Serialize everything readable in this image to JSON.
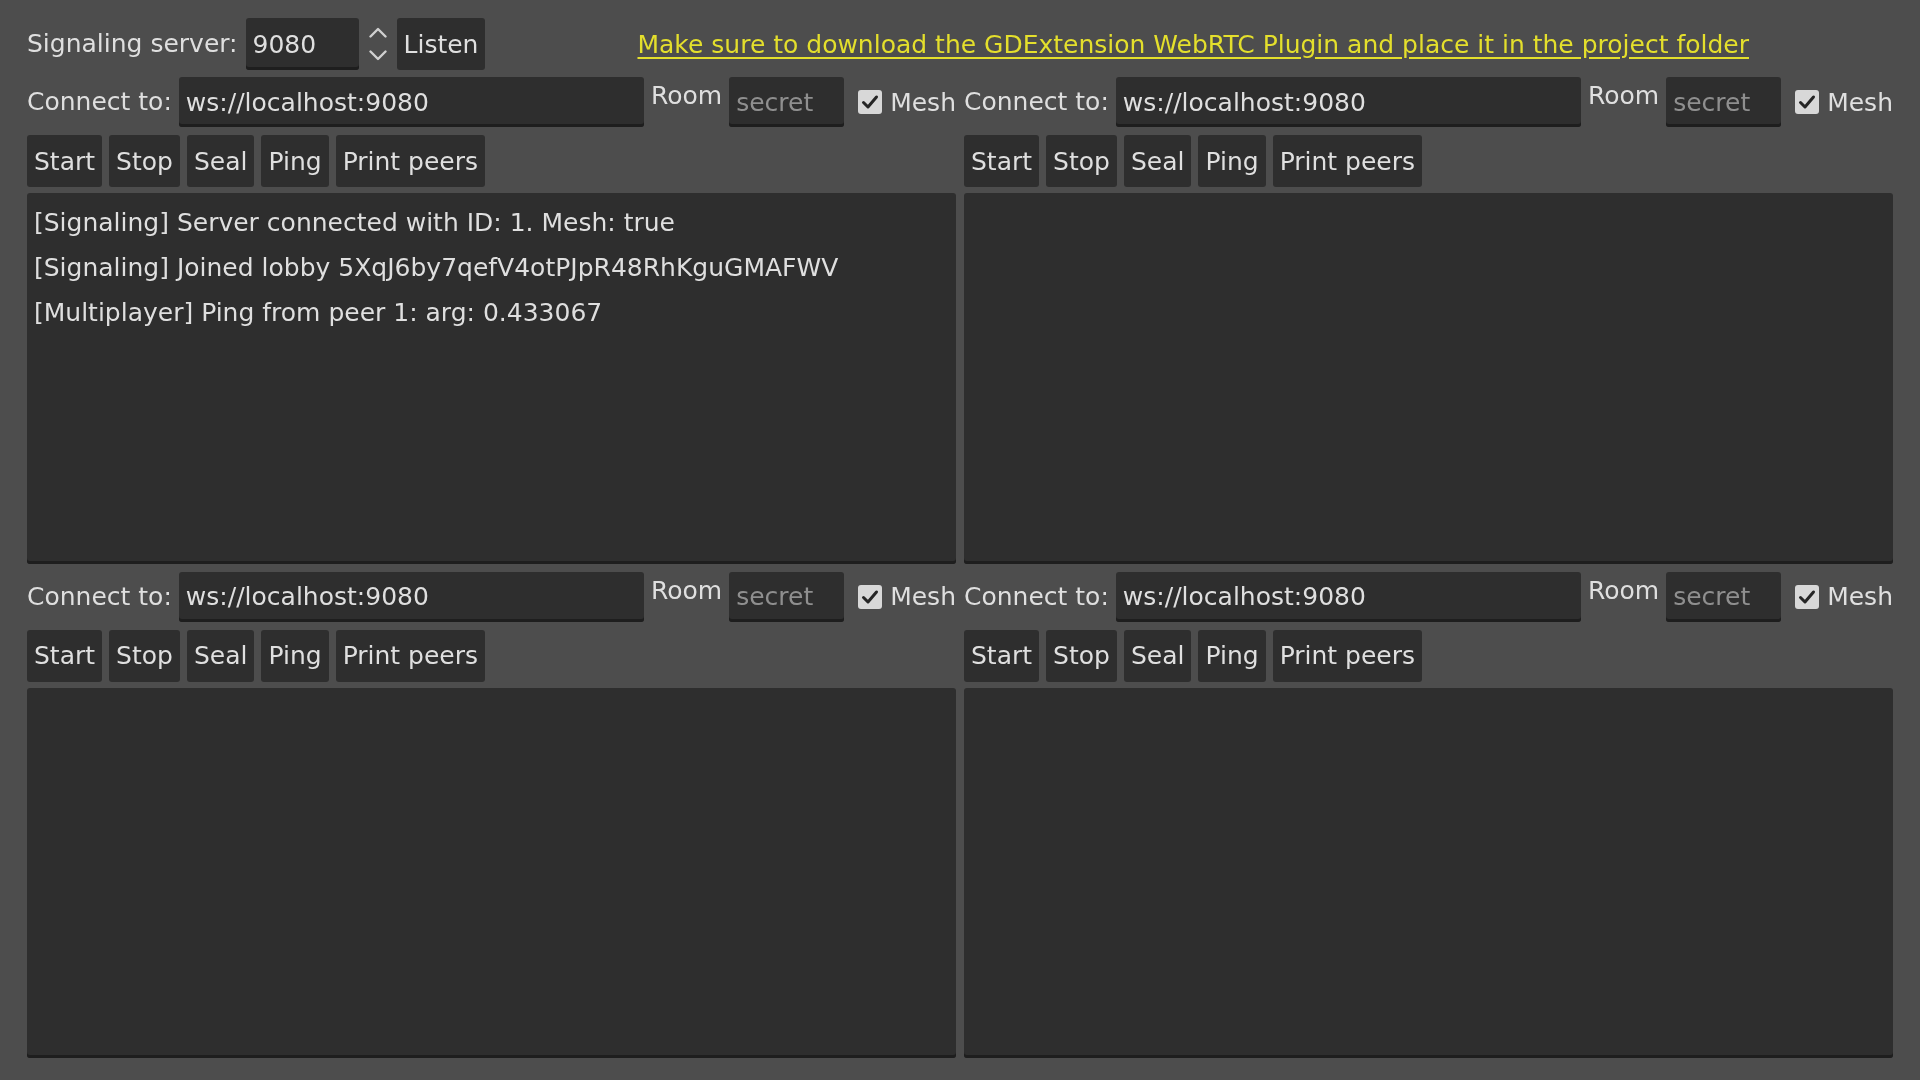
{
  "signaling_server": {
    "label": "Signaling server:",
    "port": "9080",
    "button": "Listen"
  },
  "notice_link": "Make sure to download the GDExtension WebRTC Plugin and place it in the project folder",
  "clients": [
    {
      "connect_label": "Connect to:",
      "address": "ws://localhost:9080",
      "room_label": "Room",
      "room_placeholder": "secret",
      "mesh": {
        "label": "Mesh",
        "checked": true
      },
      "buttons": [
        "Start",
        "Stop",
        "Seal",
        "Ping",
        "Print peers"
      ],
      "log": [
        "[Signaling] Server connected with ID: 1. Mesh: true",
        "[Signaling] Joined lobby 5XqJ6by7qefV4otPJpR48RhKguGMAFWV",
        "[Multiplayer] Ping from peer 1: arg: 0.433067"
      ]
    },
    {
      "connect_label": "Connect to:",
      "address": "ws://localhost:9080",
      "room_label": "Room",
      "room_placeholder": "secret",
      "mesh": {
        "label": "Mesh",
        "checked": true
      },
      "buttons": [
        "Start",
        "Stop",
        "Seal",
        "Ping",
        "Print peers"
      ]
    },
    {
      "connect_label": "Connect to:",
      "address": "ws://localhost:9080",
      "room_label": "Room",
      "room_placeholder": "secret",
      "mesh": {
        "label": "Mesh",
        "checked": true
      },
      "buttons": [
        "Start",
        "Stop",
        "Seal",
        "Ping",
        "Print peers"
      ]
    },
    {
      "connect_label": "Connect to:",
      "address": "ws://localhost:9080",
      "room_label": "Room",
      "room_placeholder": "secret",
      "mesh": {
        "label": "Mesh",
        "checked": true
      },
      "buttons": [
        "Start",
        "Stop",
        "Seal",
        "Ping",
        "Print peers"
      ]
    }
  ]
}
